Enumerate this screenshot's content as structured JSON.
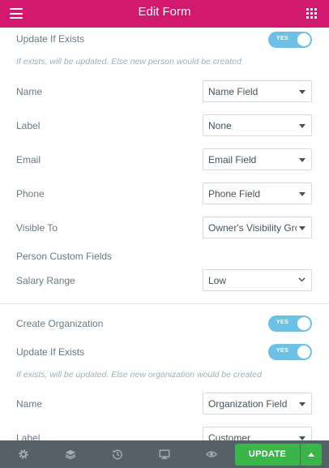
{
  "header": {
    "title": "Edit Form"
  },
  "section1": {
    "update_if_exists": {
      "label": "Update If Exists",
      "toggle": "YES",
      "hint": "If exists, will be updated. Else new person would be created"
    },
    "fields": [
      {
        "label": "Name",
        "value": "Name Field"
      },
      {
        "label": "Label",
        "value": "None"
      },
      {
        "label": "Email",
        "value": "Email Field"
      },
      {
        "label": "Phone",
        "value": "Phone Field"
      },
      {
        "label": "Visible To",
        "value": "Owner's Visibility Group"
      }
    ],
    "custom_fields_label": "Person Custom Fields",
    "salary_range": {
      "label": "Salary Range",
      "value": "Low"
    }
  },
  "section2": {
    "create_org": {
      "label": "Create Organization",
      "toggle": "YES"
    },
    "update_if_exists": {
      "label": "Update If Exists",
      "toggle": "YES",
      "hint": "If exists, will be updated. Else new organization would be created"
    },
    "fields": [
      {
        "label": "Name",
        "value": "Organization Field"
      },
      {
        "label": "Label",
        "value": "Customer"
      }
    ]
  },
  "footer": {
    "update_label": "UPDATE"
  },
  "colors": {
    "header": "#d31870",
    "toggle": "#6ec1e4",
    "update": "#39b54a",
    "footer": "#556068"
  }
}
